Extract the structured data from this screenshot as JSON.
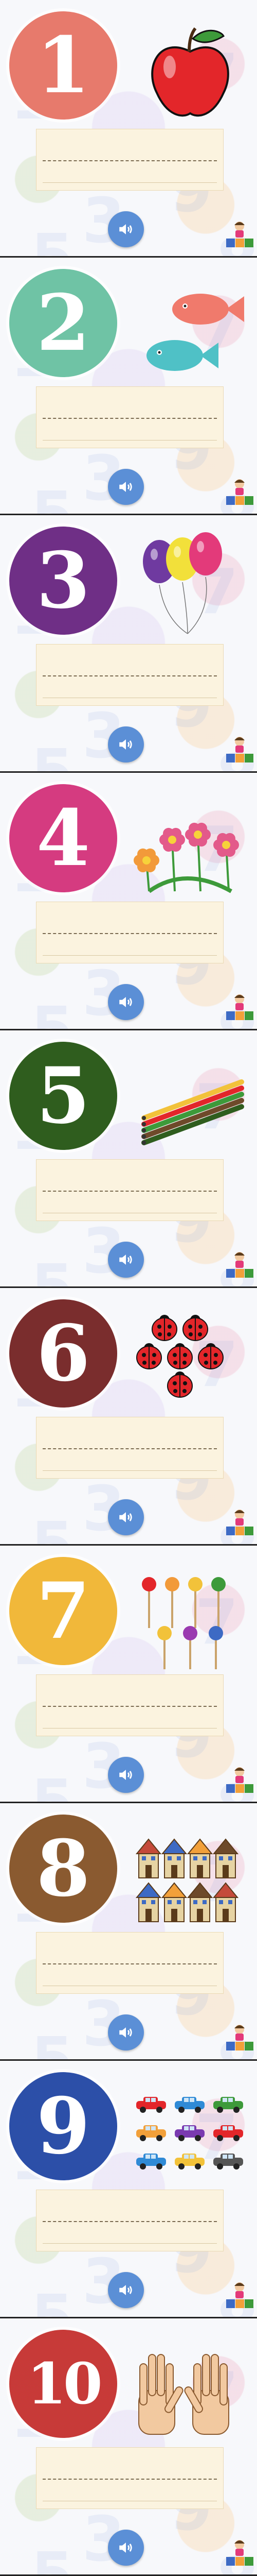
{
  "cards": [
    {
      "number": "1",
      "color": "#e77a6c",
      "picture": "apple",
      "count": 1
    },
    {
      "number": "2",
      "color": "#6fc3a5",
      "picture": "fish",
      "count": 2
    },
    {
      "number": "3",
      "color": "#6f2f86",
      "picture": "balloons",
      "count": 3
    },
    {
      "number": "4",
      "color": "#d53b80",
      "picture": "flowers",
      "count": 4
    },
    {
      "number": "5",
      "color": "#2f5d1e",
      "picture": "pencils",
      "count": 5
    },
    {
      "number": "6",
      "color": "#7a2d2d",
      "picture": "ladybugs",
      "count": 6
    },
    {
      "number": "7",
      "color": "#f1b83a",
      "picture": "lollipops",
      "count": 7
    },
    {
      "number": "8",
      "color": "#8a5a30",
      "picture": "houses",
      "count": 8
    },
    {
      "number": "9",
      "color": "#2c4fa8",
      "picture": "cars",
      "count": 9
    },
    {
      "number": "10",
      "color": "#c73a38",
      "picture": "hands",
      "count": 10
    }
  ],
  "icons": {
    "sound": "speaker-icon",
    "logo": "kids-blocks-logo"
  },
  "colors": {
    "sound_button": "#5b8fd6",
    "writing_box": "#fbf3df"
  }
}
